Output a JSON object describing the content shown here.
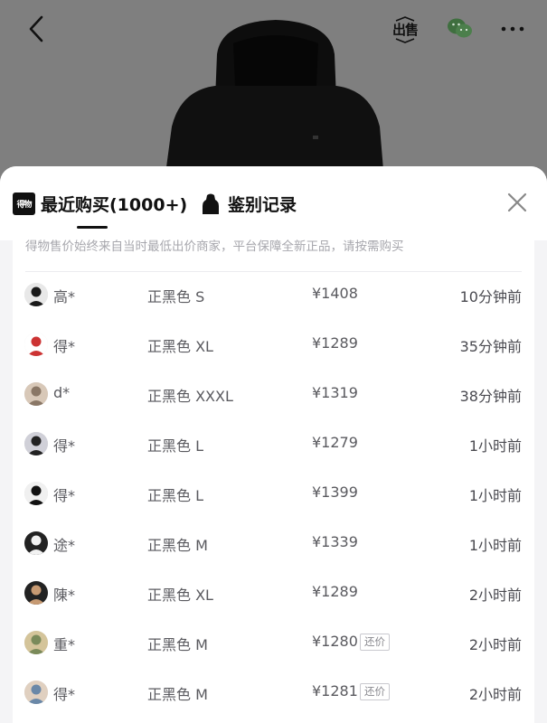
{
  "header": {
    "back_icon": "chevron-left-icon",
    "sell_label": "出售",
    "share_icon": "wechat-icon",
    "more_icon": "more-icon"
  },
  "tabs": {
    "recent_label": "最近购买(1000+)",
    "brand_badge": "得物",
    "auth_label": "鉴别记录"
  },
  "notice": "得物售价始终来自当时最低出价商家，平台保障全新正品，请按需购买",
  "records": [
    {
      "name": "高*",
      "size": "正黑色 S",
      "price": "¥1408",
      "time": "10分钟前",
      "bargain": ""
    },
    {
      "name": "得*",
      "size": "正黑色 XL",
      "price": "¥1289",
      "time": "35分钟前",
      "bargain": ""
    },
    {
      "name": "d*",
      "size": "正黑色 XXXL",
      "price": "¥1319",
      "time": "38分钟前",
      "bargain": ""
    },
    {
      "name": "得*",
      "size": "正黑色 L",
      "price": "¥1279",
      "time": "1小时前",
      "bargain": ""
    },
    {
      "name": "得*",
      "size": "正黑色 L",
      "price": "¥1399",
      "time": "1小时前",
      "bargain": ""
    },
    {
      "name": "途*",
      "size": "正黑色 M",
      "price": "¥1339",
      "time": "1小时前",
      "bargain": ""
    },
    {
      "name": "陳*",
      "size": "正黑色 XL",
      "price": "¥1289",
      "time": "2小时前",
      "bargain": ""
    },
    {
      "name": "重*",
      "size": "正黑色 M",
      "price": "¥1280",
      "time": "2小时前",
      "bargain": "还价"
    },
    {
      "name": "得*",
      "size": "正黑色 M",
      "price": "¥1281",
      "time": "2小时前",
      "bargain": "还价"
    }
  ],
  "colors": {
    "overlay": "#7f7f7f",
    "sheet_bg": "#f4f4f6",
    "text_primary": "#111111",
    "text_secondary": "#5a5a5f",
    "muted": "#a7a7ad",
    "wechat_green": "#3a6b3a"
  }
}
